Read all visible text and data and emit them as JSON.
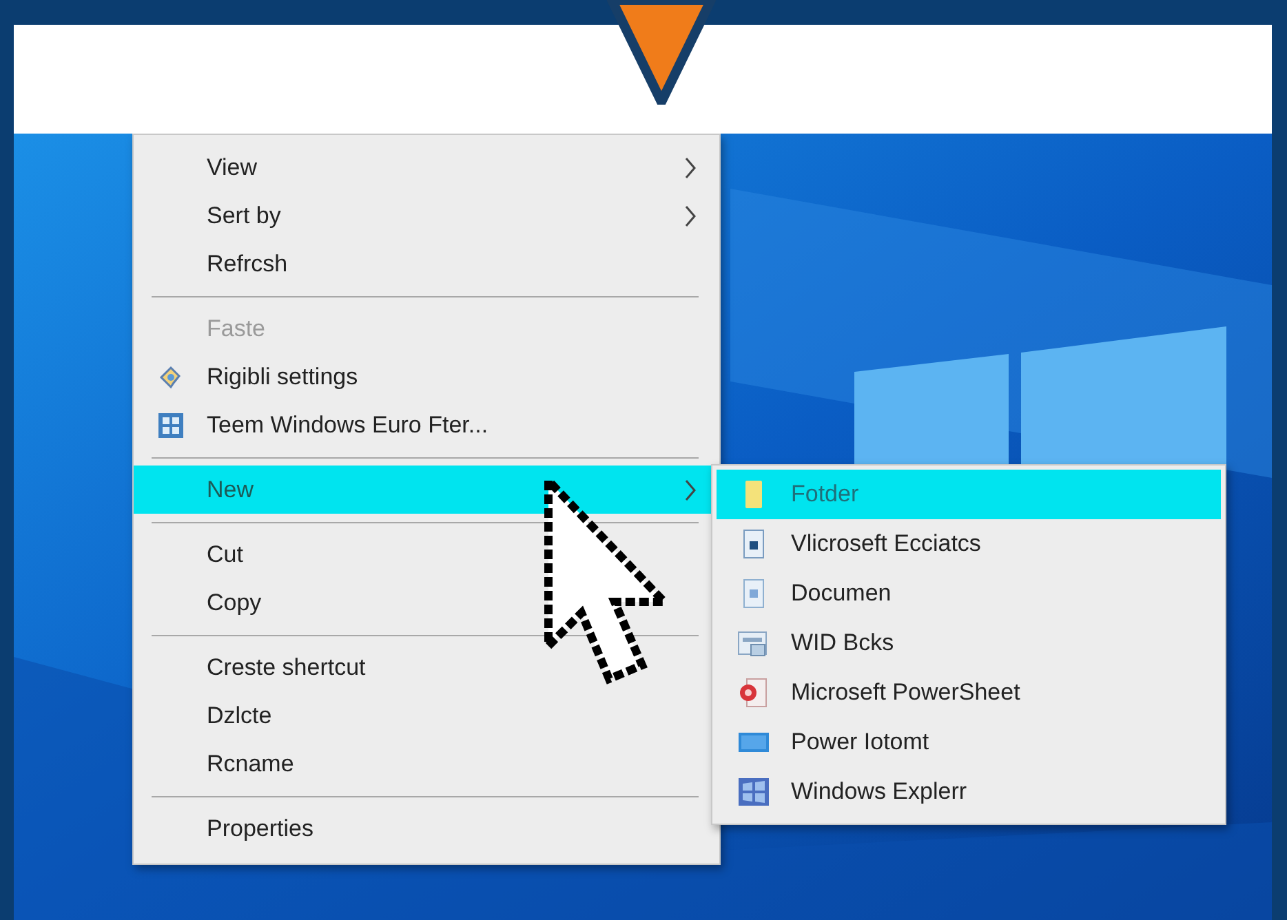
{
  "context_menu": {
    "items": [
      {
        "kind": "item",
        "label": "View",
        "submenu": true,
        "disabled": false,
        "selected": false
      },
      {
        "kind": "item",
        "label": "Sert by",
        "submenu": true,
        "disabled": false,
        "selected": false
      },
      {
        "kind": "item",
        "label": "Refrcsh",
        "submenu": false,
        "disabled": false,
        "selected": false
      },
      {
        "kind": "separator"
      },
      {
        "kind": "item",
        "label": "Faste",
        "submenu": false,
        "disabled": true,
        "selected": false
      },
      {
        "kind": "item",
        "label": "Rigibli settings",
        "submenu": false,
        "disabled": false,
        "selected": false
      },
      {
        "kind": "item",
        "label": "Teem Windows Euro Fter...",
        "submenu": false,
        "disabled": false,
        "selected": false
      },
      {
        "kind": "separator"
      },
      {
        "kind": "item",
        "label": "New",
        "submenu": true,
        "disabled": false,
        "selected": true
      },
      {
        "kind": "separator"
      },
      {
        "kind": "item",
        "label": "Cut",
        "submenu": false,
        "disabled": false,
        "selected": false
      },
      {
        "kind": "item",
        "label": "Copy",
        "submenu": false,
        "disabled": false,
        "selected": false
      },
      {
        "kind": "separator"
      },
      {
        "kind": "item",
        "label": "Creste shertcut",
        "submenu": false,
        "disabled": false,
        "selected": false
      },
      {
        "kind": "item",
        "label": "Dzlcte",
        "submenu": false,
        "disabled": false,
        "selected": false
      },
      {
        "kind": "item",
        "label": "Rcname",
        "submenu": false,
        "disabled": false,
        "selected": false
      },
      {
        "kind": "separator"
      },
      {
        "kind": "item",
        "label": "Properties",
        "submenu": false,
        "disabled": false,
        "selected": false
      }
    ]
  },
  "new_submenu": {
    "items": [
      {
        "label": "Fotder",
        "selected": true
      },
      {
        "label": "Vlicroseft Ecciatcs",
        "selected": false
      },
      {
        "label": "Documen",
        "selected": false
      },
      {
        "label": "WID Bcks",
        "selected": false
      },
      {
        "label": "Microseft PowerSheet",
        "selected": false
      },
      {
        "label": "Power Iotomt",
        "selected": false
      },
      {
        "label": "Windows Explerr",
        "selected": false
      }
    ]
  }
}
